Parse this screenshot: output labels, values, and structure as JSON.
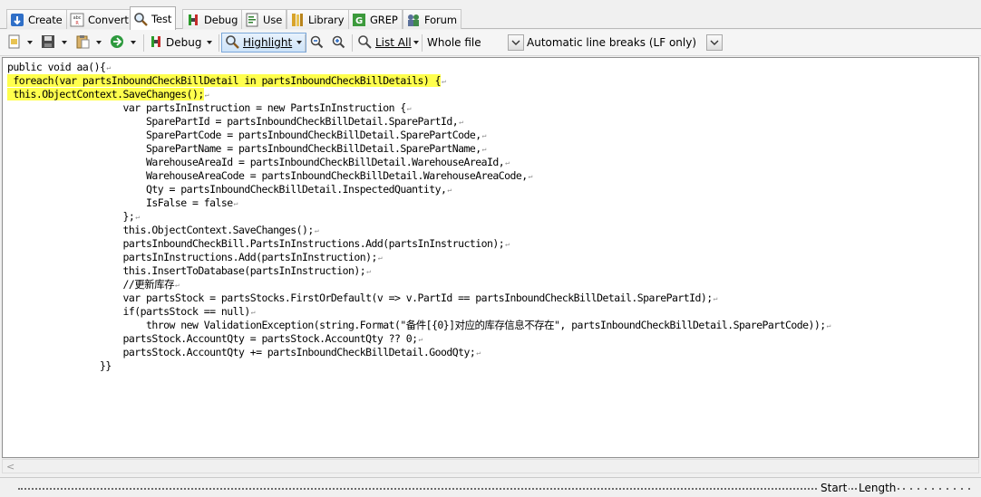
{
  "tabs": [
    {
      "label": "Create",
      "icon": "create-icon"
    },
    {
      "label": "Convert",
      "icon": "convert-icon"
    },
    {
      "label": "Test",
      "icon": "test-magnifier-icon",
      "active": true
    },
    {
      "label": "Debug",
      "icon": "debug-icon"
    },
    {
      "label": "Use",
      "icon": "use-icon"
    },
    {
      "label": "Library",
      "icon": "library-icon"
    },
    {
      "label": "GREP",
      "icon": "grep-icon"
    },
    {
      "label": "Forum",
      "icon": "forum-icon"
    }
  ],
  "toolbar": {
    "debug_label": "Debug",
    "highlight_label": "Highlight",
    "list_all_label": "List All",
    "scope_value": "Whole file",
    "line_breaks_value": "Automatic line breaks (LF only)"
  },
  "editor": {
    "lines": [
      {
        "text": "public void aa(){",
        "highlight": false
      },
      {
        "text": " foreach(var partsInboundCheckBillDetail in partsInboundCheckBillDetails) {",
        "highlight": true
      },
      {
        "text": " this.ObjectContext.SaveChanges();",
        "highlight": true
      },
      {
        "text": "                    var partsInInstruction = new PartsInInstruction {",
        "highlight": false
      },
      {
        "text": "                        SparePartId = partsInboundCheckBillDetail.SparePartId,",
        "highlight": false
      },
      {
        "text": "                        SparePartCode = partsInboundCheckBillDetail.SparePartCode,",
        "highlight": false
      },
      {
        "text": "                        SparePartName = partsInboundCheckBillDetail.SparePartName,",
        "highlight": false
      },
      {
        "text": "                        WarehouseAreaId = partsInboundCheckBillDetail.WarehouseAreaId,",
        "highlight": false
      },
      {
        "text": "                        WarehouseAreaCode = partsInboundCheckBillDetail.WarehouseAreaCode,",
        "highlight": false
      },
      {
        "text": "                        Qty = partsInboundCheckBillDetail.InspectedQuantity,",
        "highlight": false
      },
      {
        "text": "                        IsFalse = false",
        "highlight": false
      },
      {
        "text": "                    };",
        "highlight": false
      },
      {
        "text": "                    this.ObjectContext.SaveChanges();",
        "highlight": false
      },
      {
        "text": "                    partsInboundCheckBill.PartsInInstructions.Add(partsInInstruction);",
        "highlight": false
      },
      {
        "text": "                    partsInInstructions.Add(partsInInstruction);",
        "highlight": false
      },
      {
        "text": "                    this.InsertToDatabase(partsInInstruction);",
        "highlight": false
      },
      {
        "text": "                    //更新库存",
        "highlight": false
      },
      {
        "text": "                    var partsStock = partsStocks.FirstOrDefault(v => v.PartId == partsInboundCheckBillDetail.SparePartId);",
        "highlight": false
      },
      {
        "text": "                    if(partsStock == null)",
        "highlight": false
      },
      {
        "text": "                        throw new ValidationException(string.Format(\"备件[{0}]对应的库存信息不存在\", partsInboundCheckBillDetail.SparePartCode));",
        "highlight": false
      },
      {
        "text": "                    partsStock.AccountQty = partsStock.AccountQty ?? 0;",
        "highlight": false
      },
      {
        "text": "                    partsStock.AccountQty += partsInboundCheckBillDetail.GoodQty;",
        "highlight": false
      },
      {
        "text": "                }}",
        "highlight": false,
        "no_eol": true
      }
    ],
    "eol_marker": "↵",
    "highlight_color": "#ffff4d"
  },
  "status": {
    "start_label": "Start",
    "length_label": "Length"
  }
}
